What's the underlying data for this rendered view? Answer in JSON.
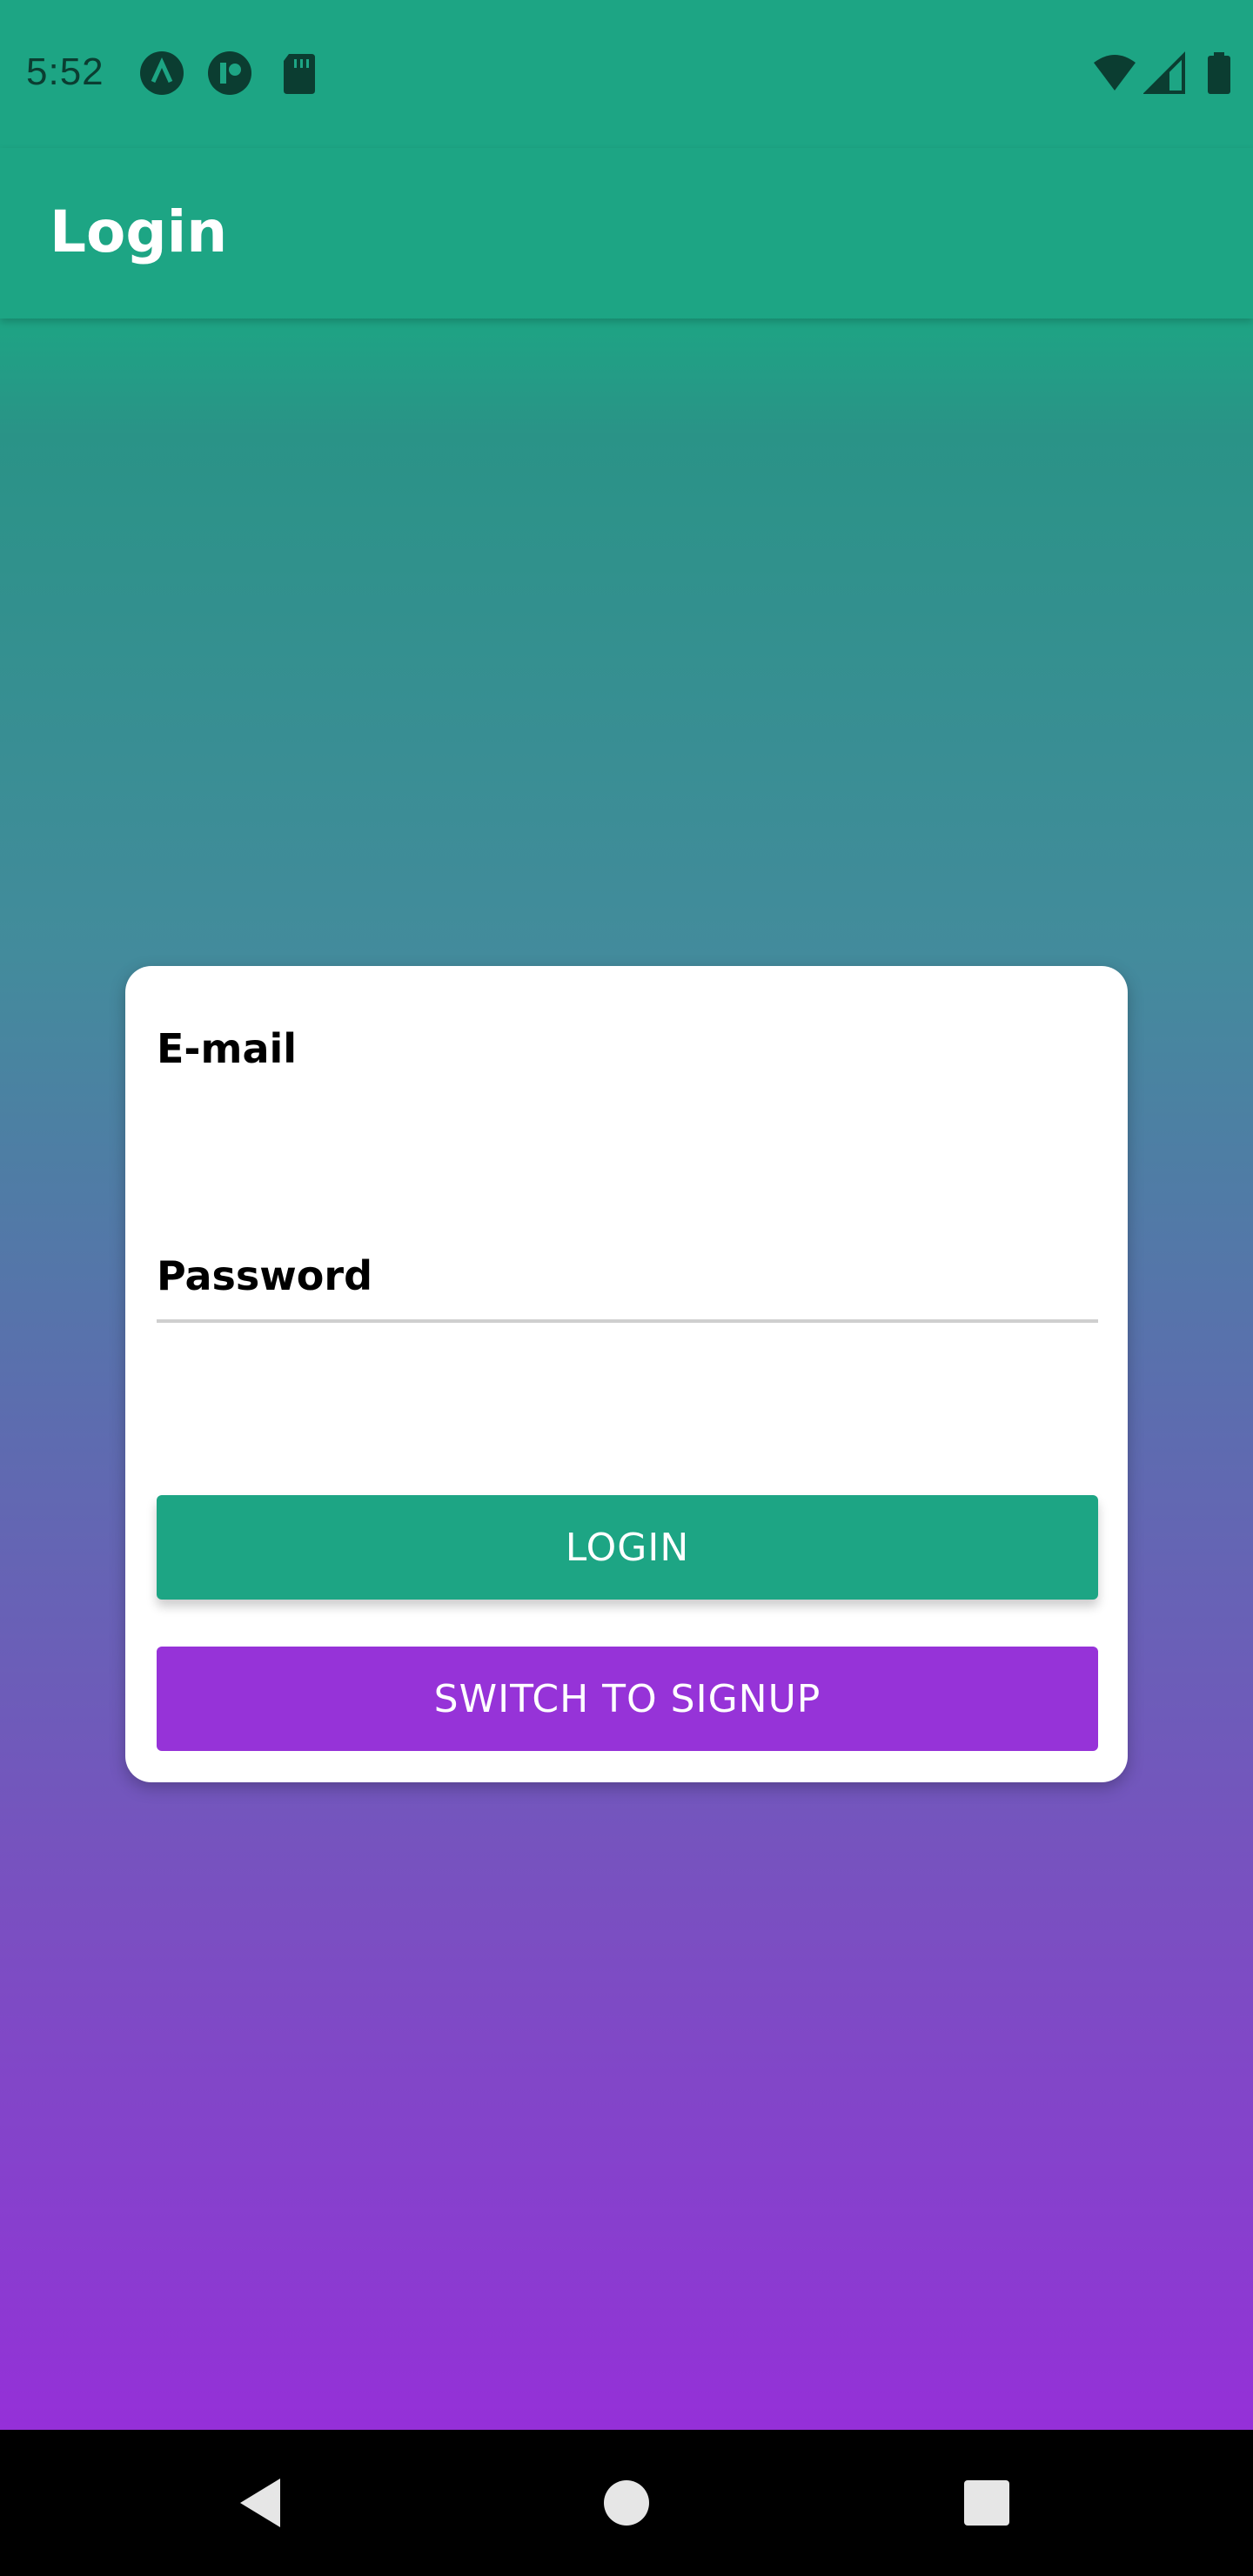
{
  "status_bar": {
    "time": "5:52",
    "left_icons": [
      "a-circle-icon",
      "p-circle-icon",
      "sd-card-icon"
    ],
    "right_icons": [
      "wifi-icon",
      "cell-signal-icon",
      "battery-icon"
    ]
  },
  "app_bar": {
    "title": "Login"
  },
  "form": {
    "email_label": "E-mail",
    "email_value": "",
    "password_label": "Password",
    "password_value": "",
    "login_button": "LOGIN",
    "switch_button": "SWITCH TO SIGNUP"
  },
  "nav_bar": {
    "icons": [
      "back-icon",
      "home-icon",
      "recents-icon"
    ]
  },
  "colors": {
    "primary": "#1da584",
    "accent": "#9633d8",
    "nav": "#000000"
  }
}
